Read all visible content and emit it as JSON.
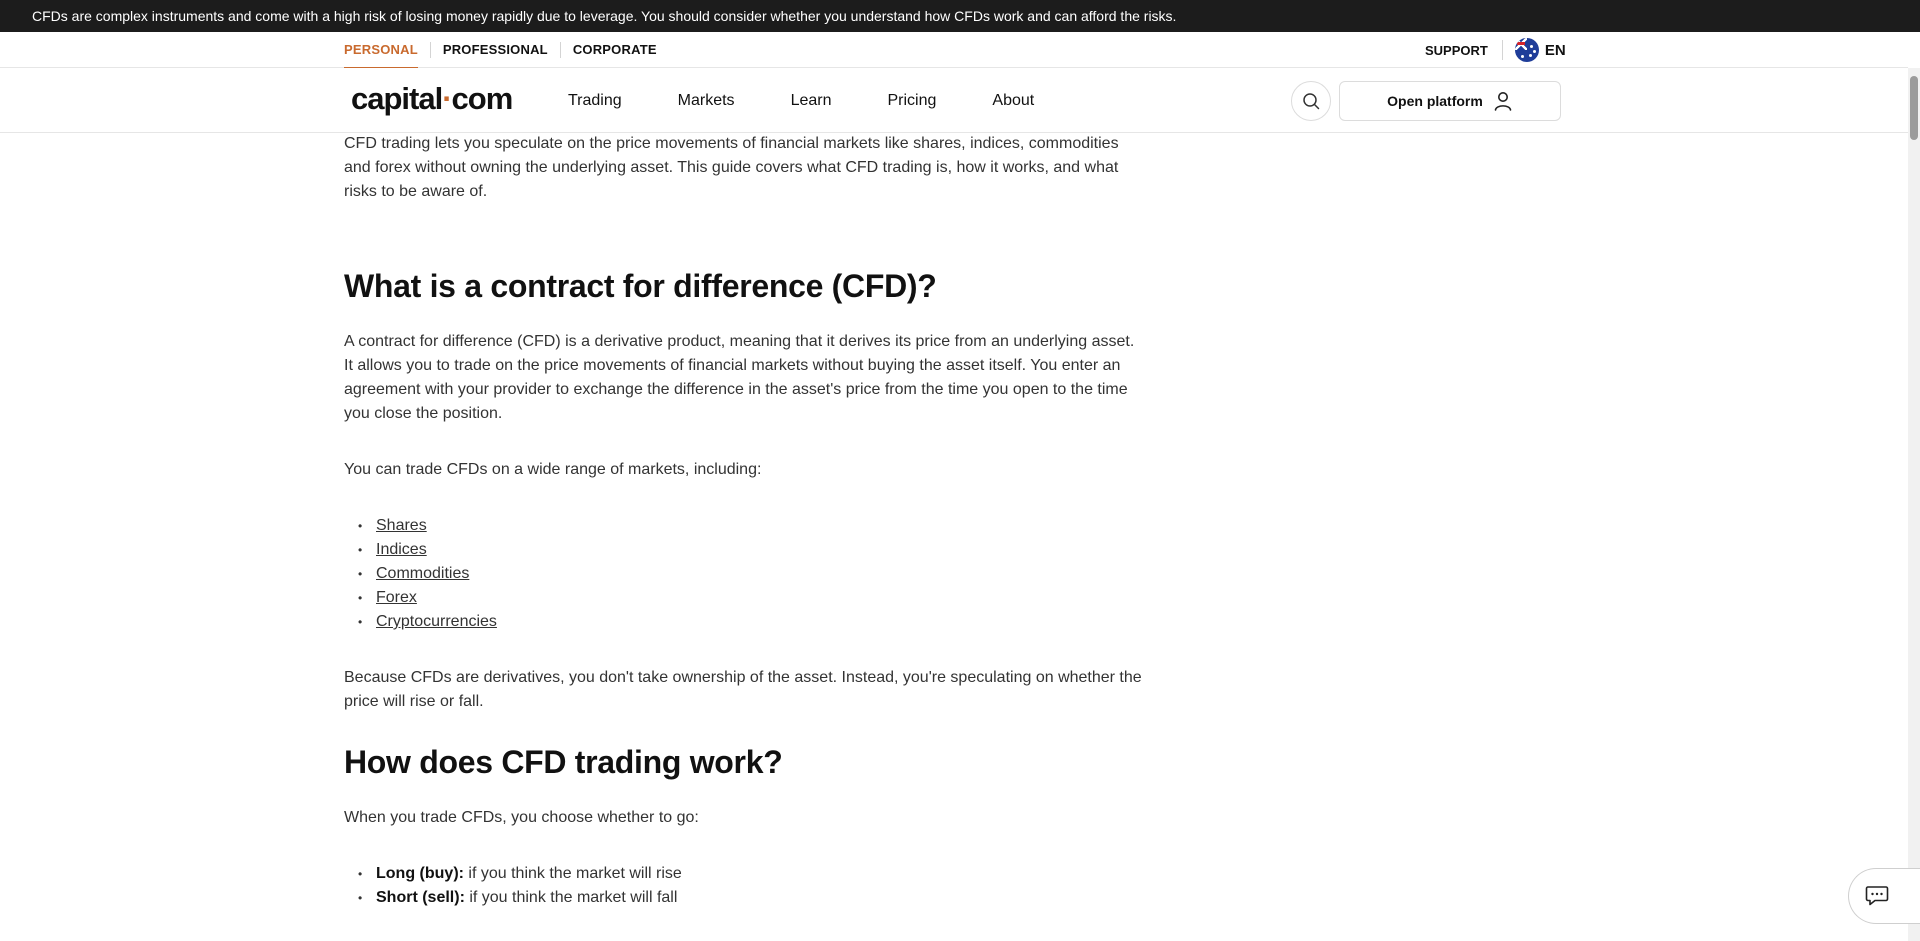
{
  "risk_warning": "CFDs are complex instruments and come with a high risk of losing money rapidly due to leverage. You should consider whether you understand how CFDs work and can afford the risks.",
  "top_nav": {
    "segments": [
      "PERSONAL",
      "PROFESSIONAL",
      "CORPORATE"
    ],
    "active_segment": "PERSONAL",
    "support": "SUPPORT",
    "language": "EN",
    "flag_icon": "australia-flag-icon"
  },
  "main_nav": {
    "logo": "capital·com",
    "menu": [
      "Trading",
      "Markets",
      "Learn",
      "Pricing",
      "About"
    ],
    "search_icon": "search-icon",
    "open_platform": "Open platform",
    "user_icon": "user-icon"
  },
  "article": {
    "intro": "CFD trading lets you speculate on the price movements of financial markets like shares, indices, commodities and forex without owning the underlying asset. This guide covers what CFD trading is, how it works, and what risks to be aware of.",
    "h_what": "What is a contract for difference (CFD)?",
    "p_what": "A contract for difference (CFD) is a derivative product, meaning that it derives its price from an underlying asset. It allows you to trade on the price movements of financial markets without buying the asset itself. You enter an agreement with your provider to exchange the difference in the asset's price from the time you open to the time you close the position.",
    "p_markets": "You can trade CFDs on a wide range of markets, including:",
    "markets": [
      "Shares",
      "Indices",
      "Commodities",
      "Forex",
      "Cryptocurrencies"
    ],
    "p_derivatives": "Because CFDs are derivatives, you don't take ownership of the asset. Instead, you're speculating on whether the price will rise or fall.",
    "h_how": "How does CFD trading work?",
    "p_how": "When you trade CFDs, you choose whether to go:",
    "directions": [
      {
        "label": "Long (buy):",
        "text": " if you think the market will rise"
      },
      {
        "label": "Short (sell):",
        "text": " if you think the market will fall"
      }
    ]
  },
  "chat_icon": "chat-icon",
  "colors": {
    "accent": "#c96a2e",
    "risk_bar": "#1c1c1c"
  }
}
